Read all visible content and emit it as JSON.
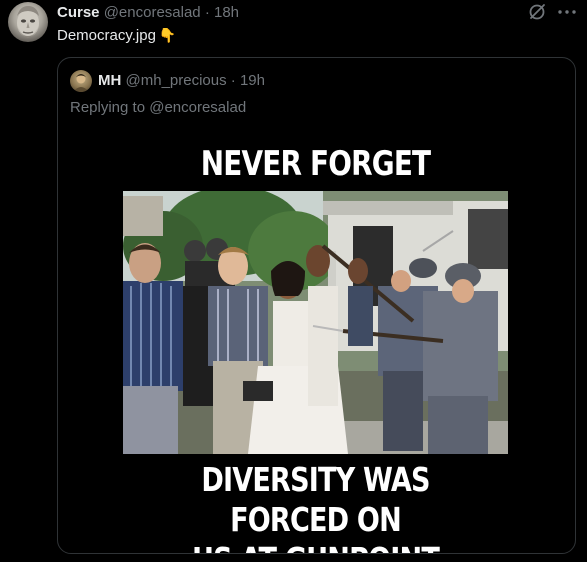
{
  "tweet": {
    "display_name": "Curse",
    "handle": "@encoresalad",
    "separator": "·",
    "time": "18h",
    "text": "Democracy.jpg",
    "emoji": "👇",
    "avatar_icon": "statue-face-avatar",
    "grok_icon": "grok-icon",
    "more_icon": "more-horizontal-icon"
  },
  "quoted_tweet": {
    "display_name": "MH",
    "handle": "@mh_precious",
    "separator": "·",
    "time": "19h",
    "replying_to_prefix": "Replying to ",
    "replying_to_handle": "@encoresalad",
    "image": {
      "top_caption": "NEVER FORGET",
      "bottom_caption_line1": "DIVERSITY WAS FORCED ON",
      "bottom_caption_line2": "US AT GUNPOINT"
    }
  },
  "colors": {
    "background": "#000000",
    "primary_text": "#e7e9ea",
    "secondary_text": "#71767b",
    "border": "#2f3336"
  }
}
